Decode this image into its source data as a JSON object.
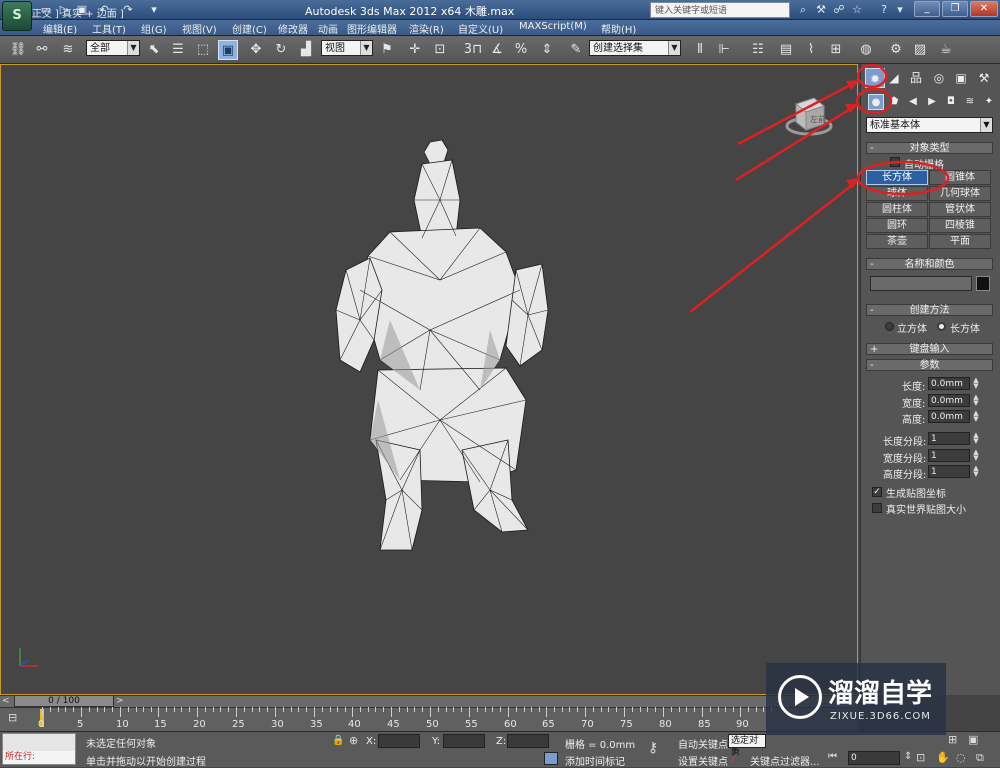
{
  "window": {
    "title": "Autodesk 3ds Max  2012 x64      木雕.max",
    "help_search_placeholder": "键入关键字或短语",
    "quick_access": [
      "new-icon",
      "open-icon",
      "save-icon",
      "undo-icon",
      "redo-icon",
      "dropdown-icon"
    ],
    "window_buttons": [
      "minimize",
      "restore",
      "close"
    ]
  },
  "menu": [
    "编辑(E)",
    "工具(T)",
    "组(G)",
    "视图(V)",
    "创建(C)",
    "修改器",
    "动画",
    "图形编辑器",
    "渲染(R)",
    "自定义(U)",
    "MAXScript(M)",
    "帮助(H)"
  ],
  "toolbar": {
    "selection_filter": "全部",
    "ref_coord": "视图",
    "named_selection": "创建选择集",
    "snap_label": "3",
    "percent_label": "%"
  },
  "viewport": {
    "label": "[ + ] 正交 ] 真实 + 边面 ]",
    "viewcube_label": "左前"
  },
  "panel": {
    "primitive_type": "标准基本体",
    "object_type": {
      "title": "对象类型",
      "autogrid": "自动栅格",
      "buttons": [
        [
          "长方体",
          "圆锥体"
        ],
        [
          "球体",
          "几何球体"
        ],
        [
          "圆柱体",
          "管状体"
        ],
        [
          "圆环",
          "四棱锥"
        ],
        [
          "茶壶",
          "平面"
        ]
      ],
      "active": "长方体"
    },
    "name_color": {
      "title": "名称和颜色",
      "name_value": ""
    },
    "creation_method": {
      "title": "创建方法",
      "options": [
        "立方体",
        "长方体"
      ],
      "selected": "长方体"
    },
    "keyboard_entry": {
      "title": "键盘输入"
    },
    "parameters": {
      "title": "参数",
      "fields": [
        {
          "label": "长度:",
          "value": "0.0mm"
        },
        {
          "label": "宽度:",
          "value": "0.0mm"
        },
        {
          "label": "高度:",
          "value": "0.0mm"
        },
        {
          "label": "长度分段:",
          "value": "1"
        },
        {
          "label": "宽度分段:",
          "value": "1"
        },
        {
          "label": "高度分段:",
          "value": "1"
        }
      ],
      "gen_mapping": "生成贴图坐标",
      "real_world": "真实世界贴图大小"
    }
  },
  "timeline": {
    "slider": "0 / 100",
    "ticks": [
      "0",
      "5",
      "10",
      "15",
      "20",
      "25",
      "30",
      "35",
      "40",
      "45",
      "50",
      "55",
      "60",
      "65",
      "70",
      "75",
      "80",
      "85",
      "90"
    ]
  },
  "status": {
    "maxscript": "所在行:",
    "line1": "未选定任何对象",
    "line2": "单击并拖动以开始创建过程",
    "x_label": "X:",
    "y_label": "Y:",
    "z_label": "Z:",
    "grid": "栅格 = 0.0mm",
    "add_time_tag": "添加时间标记",
    "auto_key": "自动关键点",
    "selected_object": "选定对象",
    "set_key": "设置关键点",
    "key_filters": "关键点过滤器...",
    "frame": "0"
  },
  "watermark": {
    "title": "溜溜自学",
    "url": "ZIXUE.3D66.COM"
  },
  "colors": {
    "annotation": "#e02020",
    "active_button": "#2e5fa0",
    "viewport_border": "#c99a2a"
  }
}
